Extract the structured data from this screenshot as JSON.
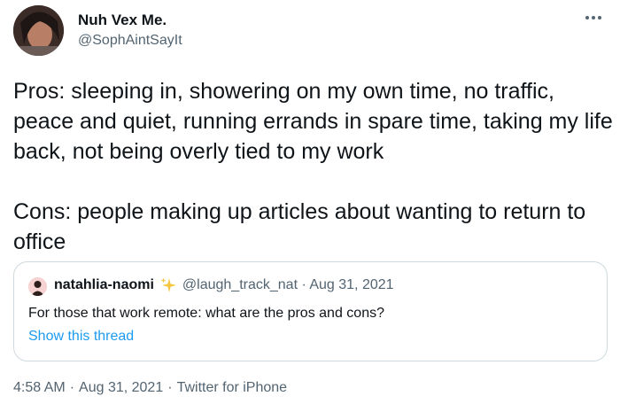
{
  "author": {
    "name": "Nuh Vex Me.",
    "handle": "@SophAintSayIt"
  },
  "tweet": {
    "text": "Pros: sleeping in, showering on my own time, no traffic, peace and quiet, running errands in spare time, taking my life back, not being overly tied to my work\n\nCons: people making up articles about wanting to return to office"
  },
  "quote": {
    "name": "natahlia-naomi",
    "meta": "@laugh_track_nat · Aug 31, 2021",
    "text": "For those that work remote: what are the pros and cons?",
    "show_thread": "Show this thread"
  },
  "footer": {
    "time": "4:58 AM",
    "date": "Aug 31, 2021",
    "separator": "·",
    "source": "Twitter for iPhone"
  },
  "colors": {
    "text_primary": "#0f1419",
    "text_secondary": "#536471",
    "link": "#1d9bf0",
    "border": "#cfd9de"
  },
  "icons": {
    "more": "more-horizontal-icon",
    "sparkle": "sparkles-icon"
  }
}
